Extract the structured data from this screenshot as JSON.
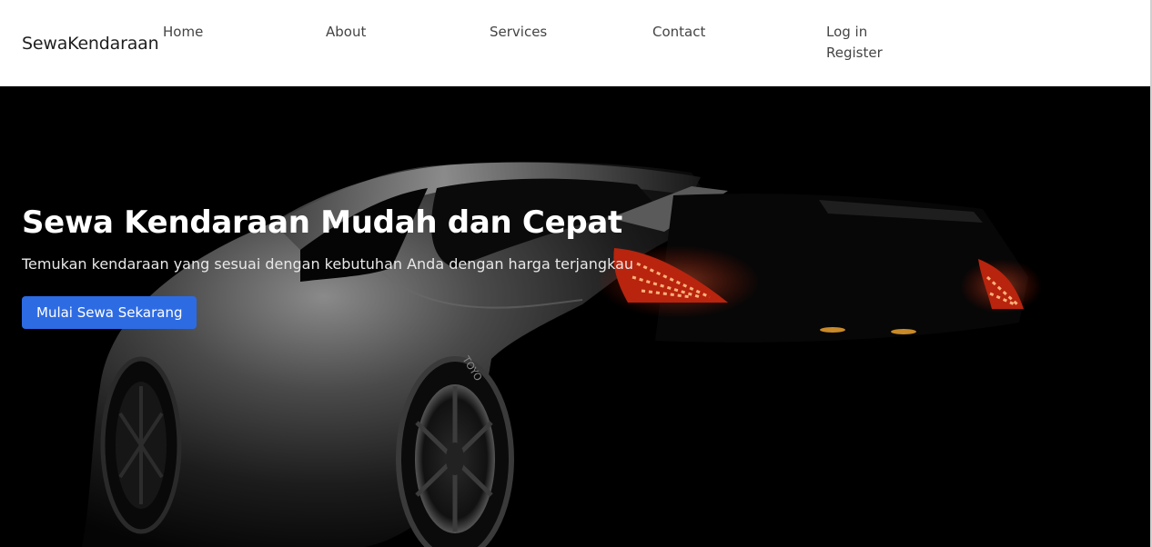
{
  "navbar": {
    "brand": "SewaKendaraan",
    "links": [
      "Home",
      "About",
      "Services",
      "Contact"
    ],
    "auth": [
      "Log in",
      "Register"
    ]
  },
  "hero": {
    "title": "Sewa Kendaraan Mudah dan Cepat",
    "subtitle": "Temukan kendaraan yang sesuai dengan kebutuhan Anda dengan harga terjangkau",
    "cta_label": "Mulai Sewa Sekarang",
    "tire_text": "TOYO",
    "accent_color": "#2d6be3"
  }
}
